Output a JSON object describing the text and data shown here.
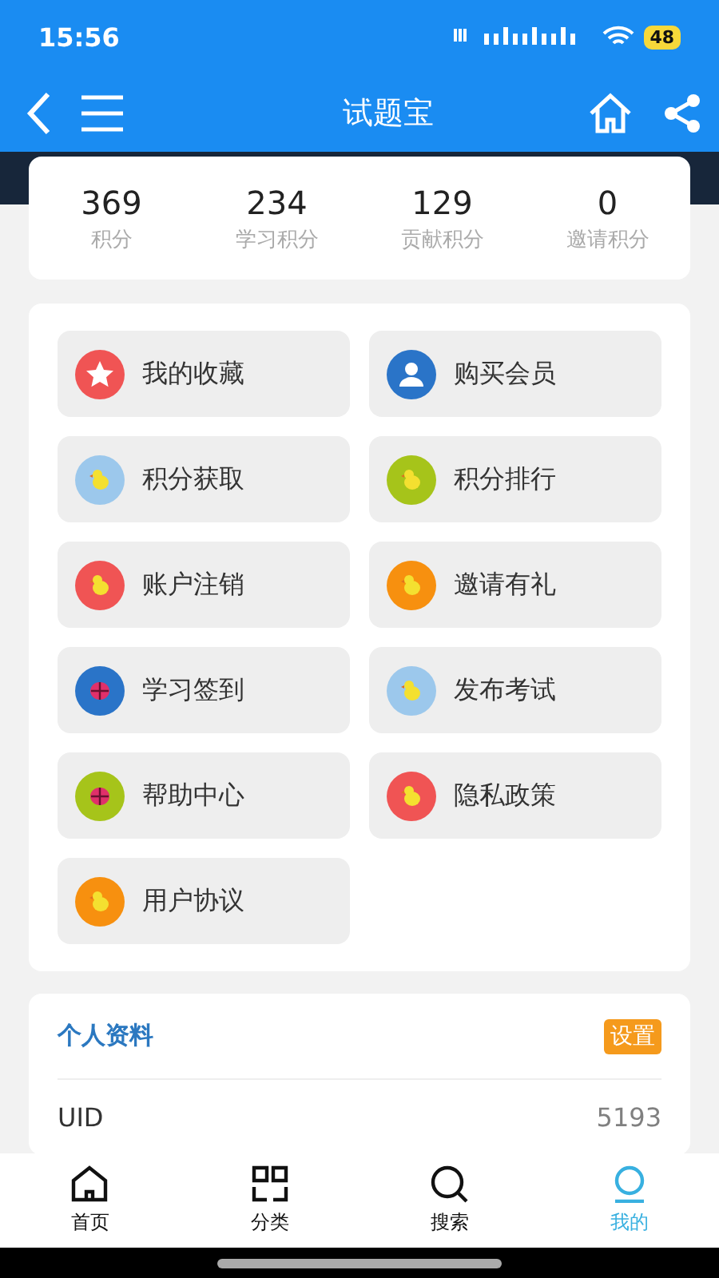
{
  "status_bar": {
    "time": "15:56",
    "battery": "48"
  },
  "header": {
    "title": "试题宝"
  },
  "stats": [
    {
      "value": "369",
      "label": "积分"
    },
    {
      "value": "234",
      "label": "学习积分"
    },
    {
      "value": "129",
      "label": "贡献积分"
    },
    {
      "value": "0",
      "label": "邀请积分"
    }
  ],
  "menu": [
    {
      "label": "我的收藏",
      "kind": "star",
      "color": "#f05454"
    },
    {
      "label": "购买会员",
      "kind": "person",
      "color": "#2a74c8"
    },
    {
      "label": "积分获取",
      "kind": "chick",
      "color": "#9cc8ec"
    },
    {
      "label": "积分排行",
      "kind": "chick",
      "color": "#a6c41a"
    },
    {
      "label": "账户注销",
      "kind": "chick",
      "color": "#f05454"
    },
    {
      "label": "邀请有礼",
      "kind": "chick",
      "color": "#f7900f"
    },
    {
      "label": "学习签到",
      "kind": "bug",
      "color": "#2a74c8"
    },
    {
      "label": "发布考试",
      "kind": "chick",
      "color": "#9cc8ec"
    },
    {
      "label": "帮助中心",
      "kind": "bug",
      "color": "#a6c41a"
    },
    {
      "label": "隐私政策",
      "kind": "chick",
      "color": "#f05454"
    },
    {
      "label": "用户协议",
      "kind": "chick",
      "color": "#f7900f"
    }
  ],
  "profile": {
    "title": "个人资料",
    "settings_button": "设置",
    "rows": [
      {
        "label": "UID",
        "value": "5193"
      }
    ]
  },
  "tabs": [
    {
      "label": "首页",
      "kind": "home",
      "selected": false
    },
    {
      "label": "分类",
      "kind": "grid",
      "selected": false
    },
    {
      "label": "搜索",
      "kind": "search",
      "selected": false
    },
    {
      "label": "我的",
      "kind": "user",
      "selected": true
    }
  ]
}
